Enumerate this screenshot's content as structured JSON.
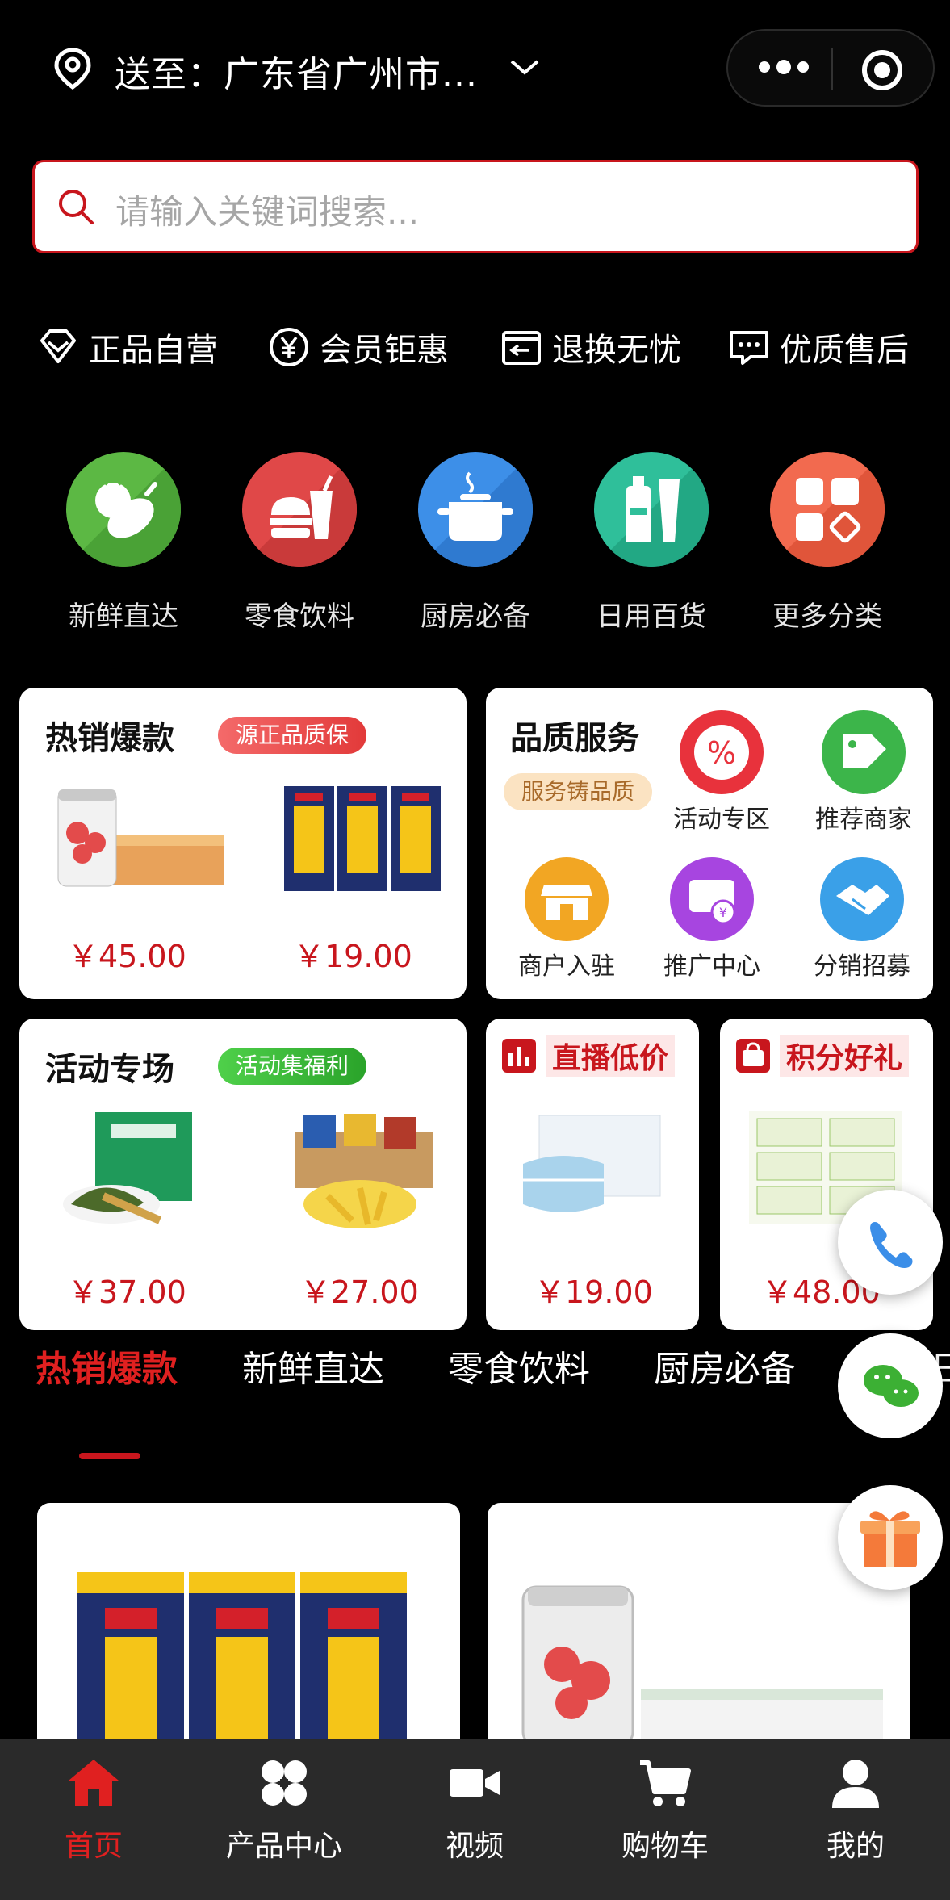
{
  "header": {
    "location_prefix": "送至：",
    "location_value": "广东省广州市...",
    "icons": [
      "location-pin-icon",
      "chevron-down-icon",
      "more-dots-icon",
      "target-icon"
    ]
  },
  "search": {
    "placeholder": "请输入关键词搜索..."
  },
  "features": [
    {
      "label": "正品自营",
      "icon": "diamond-icon"
    },
    {
      "label": "会员钜惠",
      "icon": "yen-circle-icon"
    },
    {
      "label": "退换无忧",
      "icon": "return-icon"
    },
    {
      "label": "优质售后",
      "icon": "chat-bubble-icon"
    }
  ],
  "categories": [
    {
      "label": "新鲜直达",
      "icon": "vegetables-icon",
      "color": "#5cb844"
    },
    {
      "label": "零食饮料",
      "icon": "fast-food-icon",
      "color": "#e04848"
    },
    {
      "label": "厨房必备",
      "icon": "pot-icon",
      "color": "#3d8fe8"
    },
    {
      "label": "日用百货",
      "icon": "bottles-icon",
      "color": "#2fbf9a"
    },
    {
      "label": "更多分类",
      "icon": "grid-icon",
      "color": "#f26a4f"
    }
  ],
  "hot_card": {
    "title": "热销爆款",
    "tag": "源正品质保",
    "prices": [
      "￥45.00",
      "￥19.00"
    ]
  },
  "quality_card": {
    "title": "品质服务",
    "tag": "服务铸品质",
    "services": [
      {
        "label": "活动专区",
        "icon": "discount-icon",
        "color": "#e8323c"
      },
      {
        "label": "推荐商家",
        "icon": "shop-tag-icon",
        "color": "#3cb54a"
      },
      {
        "label": "商户入驻",
        "icon": "storefront-icon",
        "color": "#f2a623"
      },
      {
        "label": "推广中心",
        "icon": "promo-icon",
        "color": "#a745e0"
      },
      {
        "label": "分销招募",
        "icon": "handshake-icon",
        "color": "#3aa0e8"
      }
    ]
  },
  "activity_card": {
    "title": "活动专场",
    "tag": "活动集福利",
    "prices": [
      "￥37.00",
      "￥27.00"
    ]
  },
  "live_card": {
    "title": "直播低价",
    "price": "￥19.00"
  },
  "points_card": {
    "title": "积分好礼",
    "price": "￥48.00"
  },
  "tabs": [
    "热销爆款",
    "新鲜直达",
    "零食饮料",
    "厨房必备",
    "日"
  ],
  "bottom_nav": [
    {
      "label": "首页",
      "icon": "home-icon",
      "active": true
    },
    {
      "label": "产品中心",
      "icon": "grid-clover-icon",
      "active": false
    },
    {
      "label": "视频",
      "icon": "video-camera-icon",
      "active": false
    },
    {
      "label": "购物车",
      "icon": "cart-icon",
      "active": false
    },
    {
      "label": "我的",
      "icon": "user-icon",
      "active": false
    }
  ],
  "colors": {
    "accent": "#c8161d",
    "active_red": "#e02020",
    "background": "#000000",
    "nav_bg": "#2a2a2a"
  }
}
